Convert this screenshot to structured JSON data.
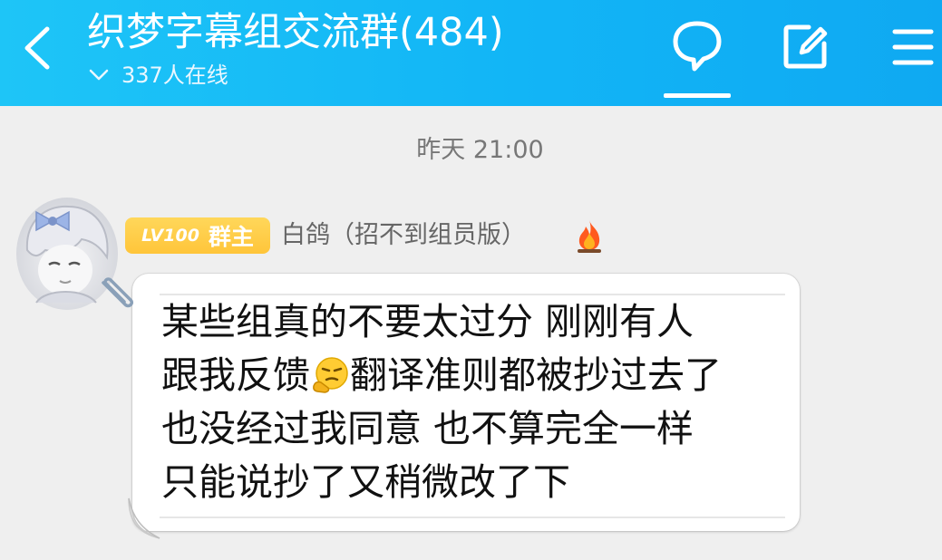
{
  "header": {
    "title": "织梦字幕组交流群(484)",
    "online": "337人在线",
    "icons": {
      "back": "chevron-left-icon",
      "chat": "chat-bubble-icon",
      "edit": "edit-note-icon",
      "menu": "menu-icon"
    }
  },
  "chat": {
    "timestamp": "昨天 21:00",
    "message": {
      "sender": {
        "level": "LV100",
        "role": "群主",
        "name": "白鸽（招不到组员版）",
        "badge_icon": "fire-icon"
      },
      "lines": [
        "某些组真的不要太过分 刚刚有人",
        "跟我反馈",
        "翻译准则都被抄过去了",
        "也没经过我同意 也不算完全一样",
        "只能说抄了又稍微改了下"
      ],
      "emoji": "thinking-smirk-emoji"
    }
  },
  "colors": {
    "header": "#12b5f6",
    "badge": "#ffc53a",
    "background": "#efefef"
  }
}
